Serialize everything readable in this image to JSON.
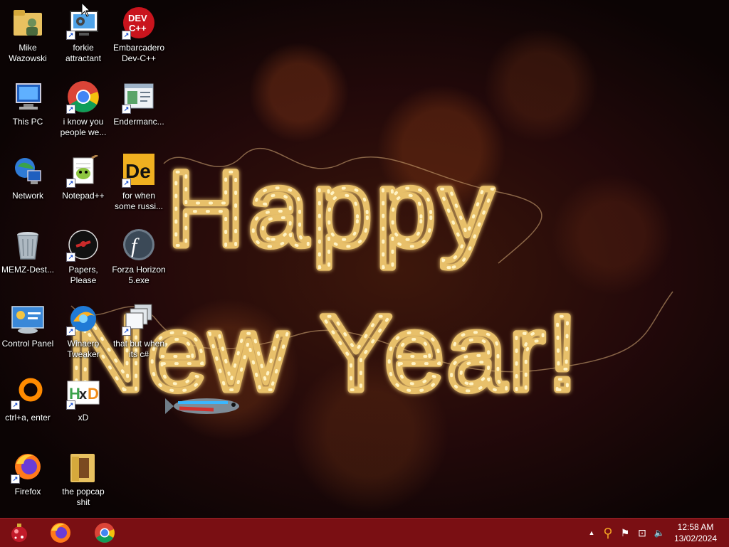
{
  "wallpaper": {
    "line1": "Happy",
    "line2": "New Year!",
    "glow_color": "#f3d58a",
    "bulb_color": "#fff3c4"
  },
  "desktop": {
    "icons": [
      {
        "label": "Mike Wazowski",
        "icon": "folder-icon",
        "shortcut": false
      },
      {
        "label": "forkie attractant",
        "icon": "monitor-gear-icon",
        "shortcut": true
      },
      {
        "label": "Embarcadero Dev-C++",
        "icon": "devcpp-icon",
        "shortcut": true
      },
      {
        "label": "This PC",
        "icon": "computer-icon",
        "shortcut": false
      },
      {
        "label": "i know you people we...",
        "icon": "chrome-icon",
        "shortcut": true
      },
      {
        "label": "Endermanc...",
        "icon": "window-app-icon",
        "shortcut": true
      },
      {
        "label": "Network",
        "icon": "network-icon",
        "shortcut": false
      },
      {
        "label": "Notepad++",
        "icon": "notepadpp-icon",
        "shortcut": true
      },
      {
        "label": "for when some russi...",
        "icon": "de-app-icon",
        "shortcut": true
      },
      {
        "label": "MEMZ-Dest...",
        "icon": "recycle-bin-icon",
        "shortcut": false
      },
      {
        "label": "Papers, Please",
        "icon": "papers-please-icon",
        "shortcut": true
      },
      {
        "label": "Forza Horizon 5.exe",
        "icon": "flash-icon",
        "shortcut": false
      },
      {
        "label": "Control Panel",
        "icon": "control-panel-icon",
        "shortcut": false
      },
      {
        "label": "Winaero Tweaker",
        "icon": "winaero-icon",
        "shortcut": true
      },
      {
        "label": "that but when its c#",
        "icon": "stacked-windows-icon",
        "shortcut": true
      },
      {
        "label": "ctrl+a, enter",
        "icon": "orange-ring-icon",
        "shortcut": true
      },
      {
        "label": "xD",
        "icon": "hxd-icon",
        "shortcut": true
      },
      {
        "label": "Firefox",
        "icon": "firefox-icon",
        "shortcut": true
      },
      {
        "label": "the popcap shit",
        "icon": "folder-icon",
        "shortcut": false
      }
    ]
  },
  "taskbar": {
    "start_icon": "start-ornament-icon",
    "pinned": [
      {
        "name": "Firefox",
        "icon": "firefox-icon"
      },
      {
        "name": "Google Chrome",
        "icon": "chrome-icon"
      }
    ],
    "tray": {
      "overflow_glyph": "▲",
      "search_glyph": "⚲",
      "flag_glyph": "⚑",
      "network_glyph": "⊡",
      "volume_glyph": "🔈"
    },
    "clock": {
      "time": "12:58 AM",
      "date": "13/02/2024"
    },
    "color": "#7a0f13"
  }
}
